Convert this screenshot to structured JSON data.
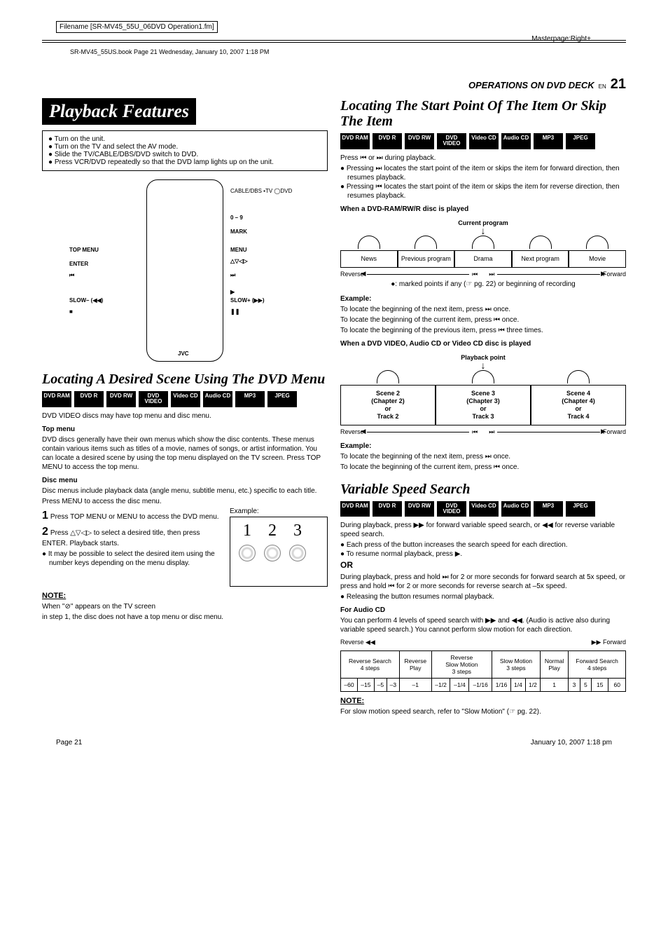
{
  "meta": {
    "filename_label": "Filename [SR-MV45_55U_06DVD Operation1.fm]",
    "book_line": "SR-MV45_55US.book  Page 21  Wednesday, January 10, 2007  1:18 PM",
    "masterpage": "Masterpage:Right+",
    "ops_header": "OPERATIONS ON DVD DECK",
    "en": "EN",
    "page_num": "21",
    "footer_page": "Page 21",
    "footer_date": "January 10, 2007 1:18 pm"
  },
  "titles": {
    "playback_features": "Playback Features",
    "locating_scene": "Locating A Desired Scene Using The DVD Menu",
    "locating_start": "Locating The Start Point Of The Item Or Skip The Item",
    "variable_speed": "Variable Speed Search"
  },
  "intro": {
    "items": [
      "Turn on the unit.",
      "Turn on the TV and select the AV mode.",
      "Slide the TV/CABLE/DBS/DVD switch to DVD.",
      "Press VCR/DVD repeatedly so that the DVD lamp lights up on the unit."
    ]
  },
  "remote_labels": {
    "top_menu": "TOP MENU",
    "enter": "ENTER",
    "prev": "⏮",
    "slow_minus": "SLOW– (◀◀)",
    "stop": "■",
    "cable": "CABLE/DBS ▪TV ◯DVD",
    "nums": "0 – 9",
    "mark": "MARK",
    "menu": "MENU",
    "arrows": "△▽◁▷",
    "next": "⏭",
    "play": "▶",
    "slow_plus": "SLOW+ (▶▶)",
    "pause": "❚❚",
    "jvc": "JVC"
  },
  "formats": {
    "dvd_ram": "DVD\nRAM",
    "dvd_r": "DVD\nR",
    "dvd_rw": "DVD\nRW",
    "dvd_video": "DVD\nVIDEO",
    "video_cd": "Video\nCD",
    "audio_cd": "Audio\nCD",
    "mp3": "MP3",
    "jpeg": "JPEG"
  },
  "locating_scene": {
    "intro": "DVD VIDEO discs may have top menu and disc menu.",
    "top_menu_h": "Top menu",
    "top_menu_p": "DVD discs generally have their own menus which show the disc contents. These menus contain various items such as titles of a movie, names of songs, or artist information. You can locate a desired scene by using the top menu displayed on the TV screen. Press TOP MENU to access the top menu.",
    "disc_menu_h": "Disc menu",
    "disc_menu_p1": "Disc menus include playback data (angle menu, subtitle menu, etc.) specific to each title.",
    "disc_menu_p2": "Press MENU to access the disc menu.",
    "step1": "Press TOP MENU or MENU to access the DVD menu.",
    "step2": "Press △▽◁▷ to select a desired title, then press ENTER. Playback starts.",
    "step2_bullet": "It may be possible to select the desired item using the number keys depending on the menu display.",
    "example_label": "Example:",
    "note_h": "NOTE:",
    "note_p1": "When \"⊘\" appears on the TV screen",
    "note_p2": "in step 1, the disc does not have a top menu or disc menu."
  },
  "locating_start": {
    "press_line": "Press ⏮ or ⏭ during playback.",
    "b1": "Pressing ⏭ locates the start point of the item or skips the item for forward direction, then resumes playback.",
    "b2": "Pressing ⏮ locates the start point of the item or skips the item for reverse direction, then resumes playback.",
    "when_ram_h": "When a DVD-RAM/RW/R disc is played",
    "current_program": "Current program",
    "cells_ram": [
      "News",
      "Previous program",
      "Drama",
      "Next program",
      "Movie"
    ],
    "reverse": "Reverse",
    "forward": "Forward",
    "marked_note": "●: marked points if any (☞ pg. 22) or beginning of recording",
    "example_h": "Example:",
    "ex_ram_1": "To locate the beginning of the next item, press ⏭ once.",
    "ex_ram_2": "To locate the beginning of the current item, press ⏮ once.",
    "ex_ram_3": "To locate the beginning of the previous item, press ⏮ three times.",
    "when_video_h": "When a DVD VIDEO, Audio CD or Video CD disc is played",
    "playback_point": "Playback point",
    "cells_video": [
      "Scene 2\n(Chapter 2)\nor\nTrack 2",
      "Scene 3\n(Chapter 3)\nor\nTrack 3",
      "Scene 4\n(Chapter 4)\nor\nTrack 4"
    ],
    "ex_vid_1": "To locate the beginning of the next item, press ⏭ once.",
    "ex_vid_2": "To locate the beginning of the current item, press ⏮ once."
  },
  "variable_speed": {
    "p1": "During playback, press ▶▶ for forward variable speed search, or ◀◀ for reverse variable speed search.",
    "b1": "Each press of the button increases the search speed for each direction.",
    "b2": "To resume normal playback, press ▶.",
    "or": "OR",
    "p2": "During playback, press and hold ⏭ for 2 or more seconds for forward search at 5x speed, or press and hold ⏮ for 2 or more seconds for reverse search at –5x speed.",
    "b3": "Releasing the button resumes normal playback.",
    "audio_h": "For Audio CD",
    "audio_p": "You can perform 4 levels of speed search with ▶▶ and ◀◀. (Audio is active also during variable speed search.) You cannot perform slow motion for each direction.",
    "rev_label": "Reverse ◀◀",
    "fwd_label": "▶▶ Forward",
    "headers": [
      "Reverse Search\n4 steps",
      "Reverse\nPlay",
      "Reverse\nSlow Motion\n3 steps",
      "Slow Motion\n3 steps",
      "Normal\nPlay",
      "Forward Search\n4 steps"
    ],
    "row": [
      "–60",
      "–15",
      "–5",
      "–3",
      "–1",
      "–1/2",
      "–1/4",
      "–1/16",
      "1/16",
      "1/4",
      "1/2",
      "1",
      "3",
      "5",
      "15",
      "60"
    ],
    "note_h": "NOTE:",
    "note_p": "For slow motion speed search, refer to \"Slow Motion\" (☞ pg. 22)."
  },
  "chart_data": {
    "type": "table",
    "title": "Variable speed search levels",
    "columns": [
      "Reverse Search 4 steps",
      "Reverse Search 4 steps",
      "Reverse Search 4 steps",
      "Reverse Search 4 steps",
      "Reverse Play",
      "Reverse Slow Motion",
      "Reverse Slow Motion",
      "Reverse Slow Motion",
      "Slow Motion",
      "Slow Motion",
      "Slow Motion",
      "Normal Play",
      "Forward Search 4 steps",
      "Forward Search 4 steps",
      "Forward Search 4 steps",
      "Forward Search 4 steps"
    ],
    "values": [
      -60,
      -15,
      -5,
      -3,
      -1,
      -0.5,
      -0.25,
      -0.0625,
      0.0625,
      0.25,
      0.5,
      1,
      3,
      5,
      15,
      60
    ]
  }
}
